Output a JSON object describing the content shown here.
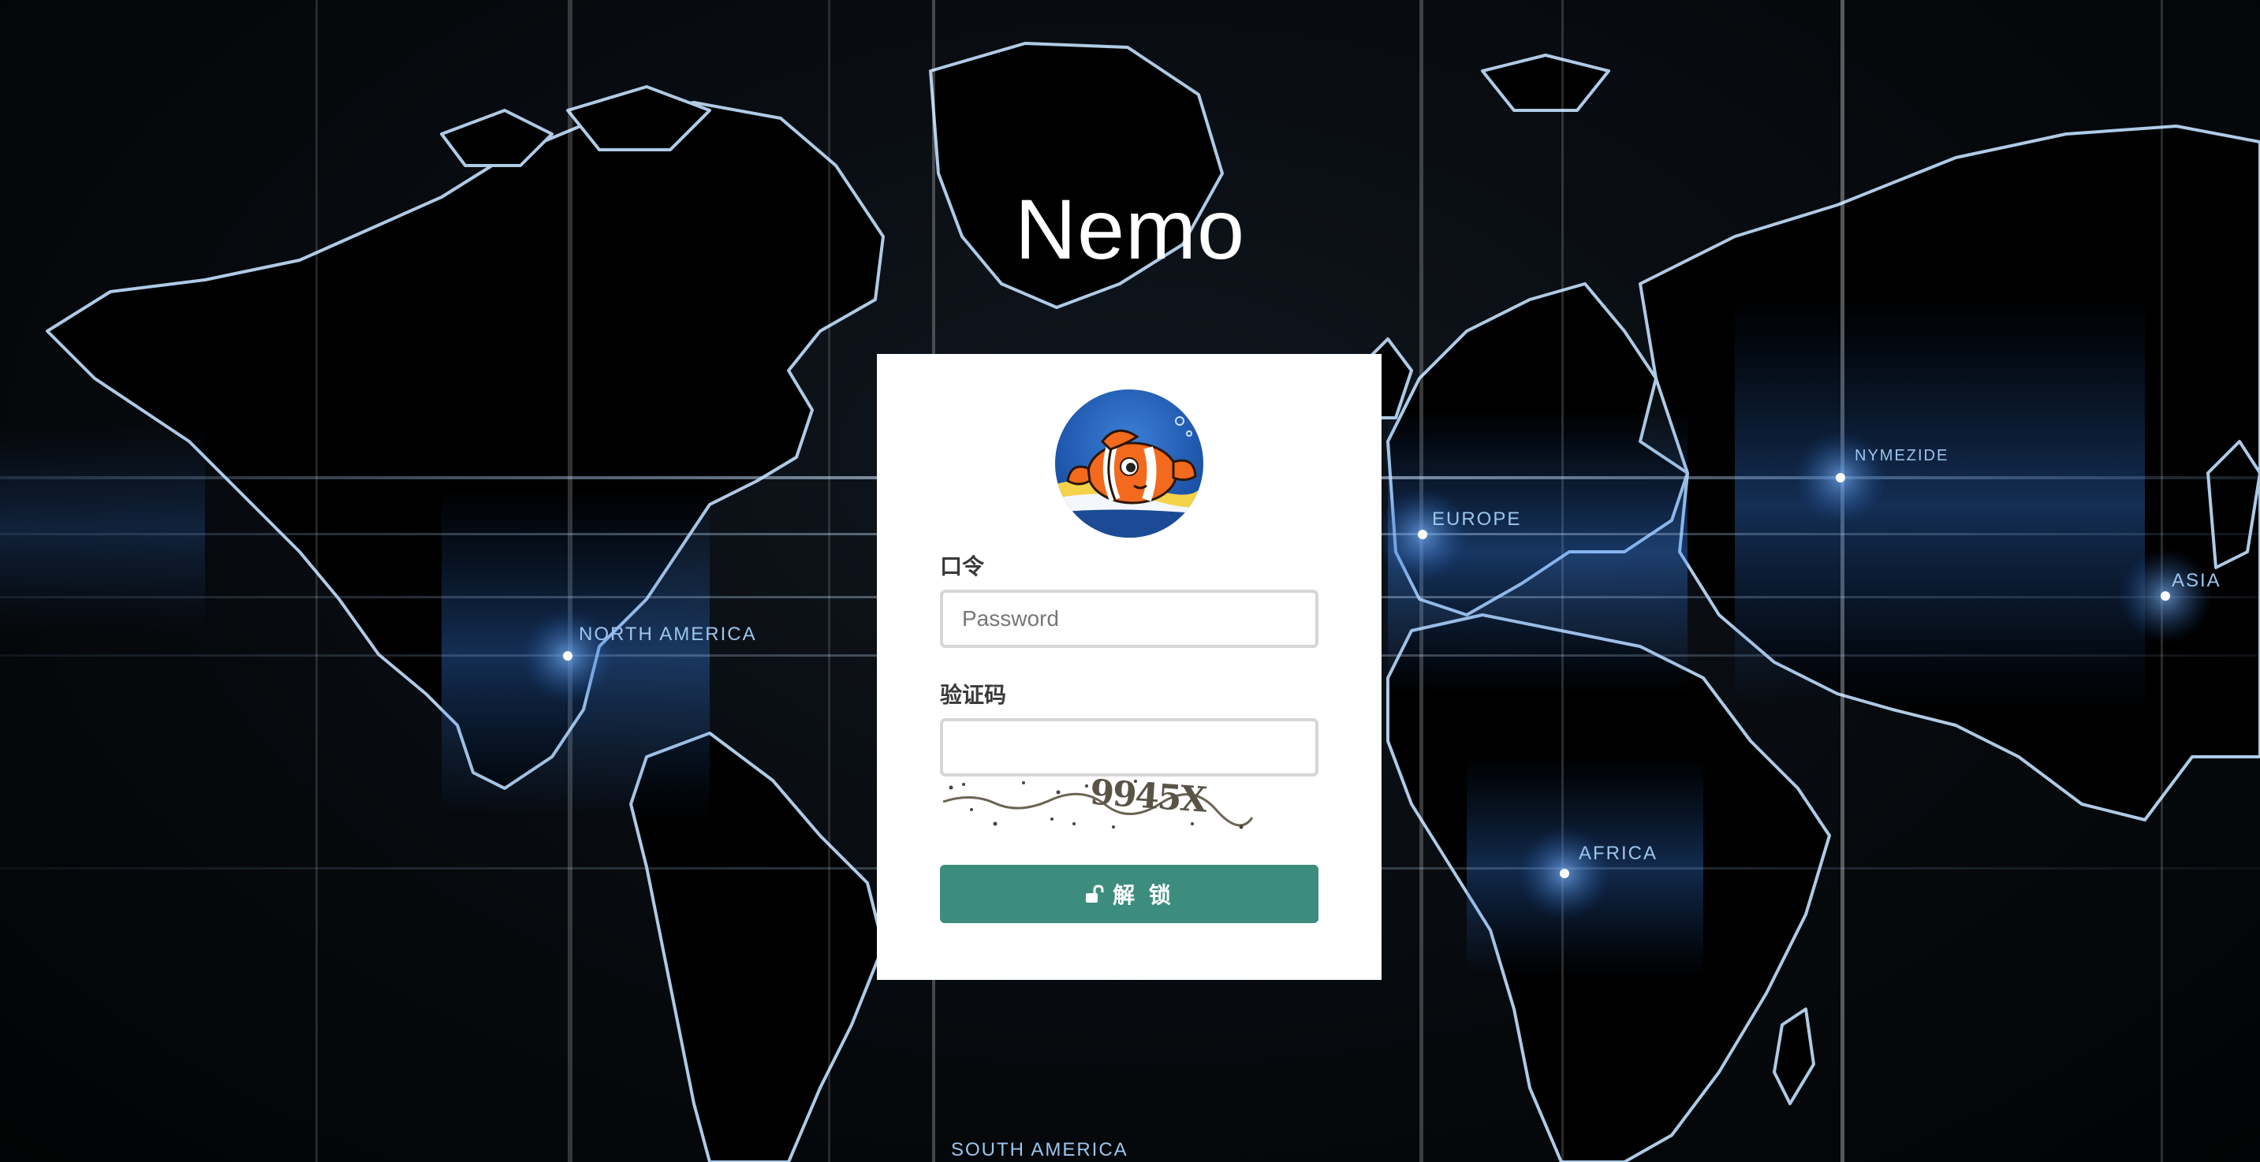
{
  "app": {
    "title": "Nemo"
  },
  "background": {
    "map_labels": [
      "NORTH AMERICA",
      "EUROPE",
      "NYMEZIDE",
      "ASIA",
      "AFRICA",
      "SOUTH AMERICA"
    ]
  },
  "login": {
    "password_label": "口令",
    "password_placeholder": "Password",
    "password_value": "",
    "captcha_label": "验证码",
    "captcha_value": "",
    "captcha_image_text": "9945X",
    "unlock_icon": "unlock-icon",
    "unlock_label": "解 锁"
  },
  "colors": {
    "button": "#3d8d7e",
    "card": "#ffffff",
    "background": "#05080c",
    "map_glow": "#4a9cff"
  }
}
